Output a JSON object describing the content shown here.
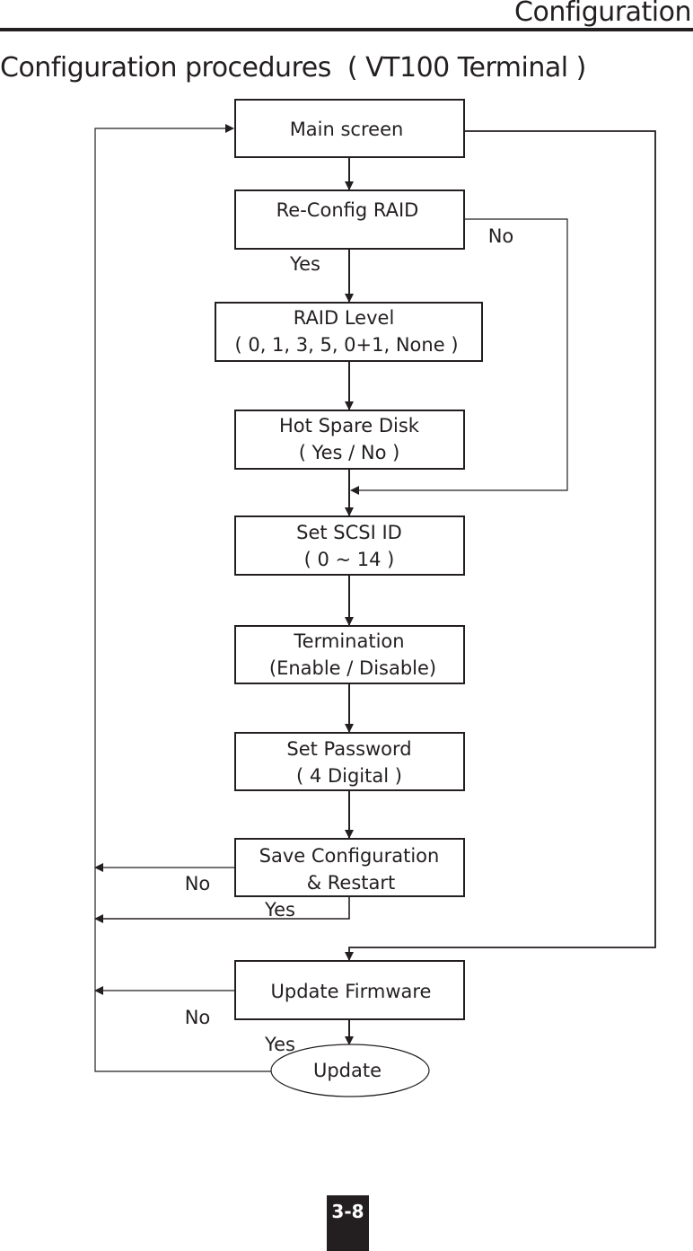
{
  "header": {
    "section_title": "Configuration"
  },
  "page_title": "Configuration procedures  ( VT100 Terminal )",
  "flowchart": {
    "nodes": {
      "main_screen": {
        "lines": [
          "Main screen"
        ]
      },
      "reconfig_raid": {
        "lines": [
          "Re-Config RAID"
        ]
      },
      "raid_level": {
        "lines": [
          "RAID Level",
          "( 0, 1, 3, 5, 0+1, None )"
        ]
      },
      "hot_spare": {
        "lines": [
          "Hot Spare Disk",
          "( Yes / No )"
        ]
      },
      "scsi_id": {
        "lines": [
          "Set SCSI ID",
          "( 0 ~ 14 )"
        ]
      },
      "termination": {
        "lines": [
          "Termination",
          "(Enable / Disable)"
        ]
      },
      "password": {
        "lines": [
          "Set Password",
          "( 4 Digital )"
        ]
      },
      "save_config": {
        "lines": [
          "Save Configuration",
          "& Restart"
        ]
      },
      "update_firmware": {
        "lines": [
          "Update Firmware"
        ]
      },
      "update": {
        "lines": [
          "Update"
        ]
      }
    },
    "edge_labels": {
      "reconfig_yes": "Yes",
      "reconfig_no": "No",
      "save_no": "No",
      "save_yes": "Yes",
      "firmware_no": "No",
      "firmware_yes": "Yes"
    }
  },
  "footer": {
    "page_number": "3-8"
  }
}
